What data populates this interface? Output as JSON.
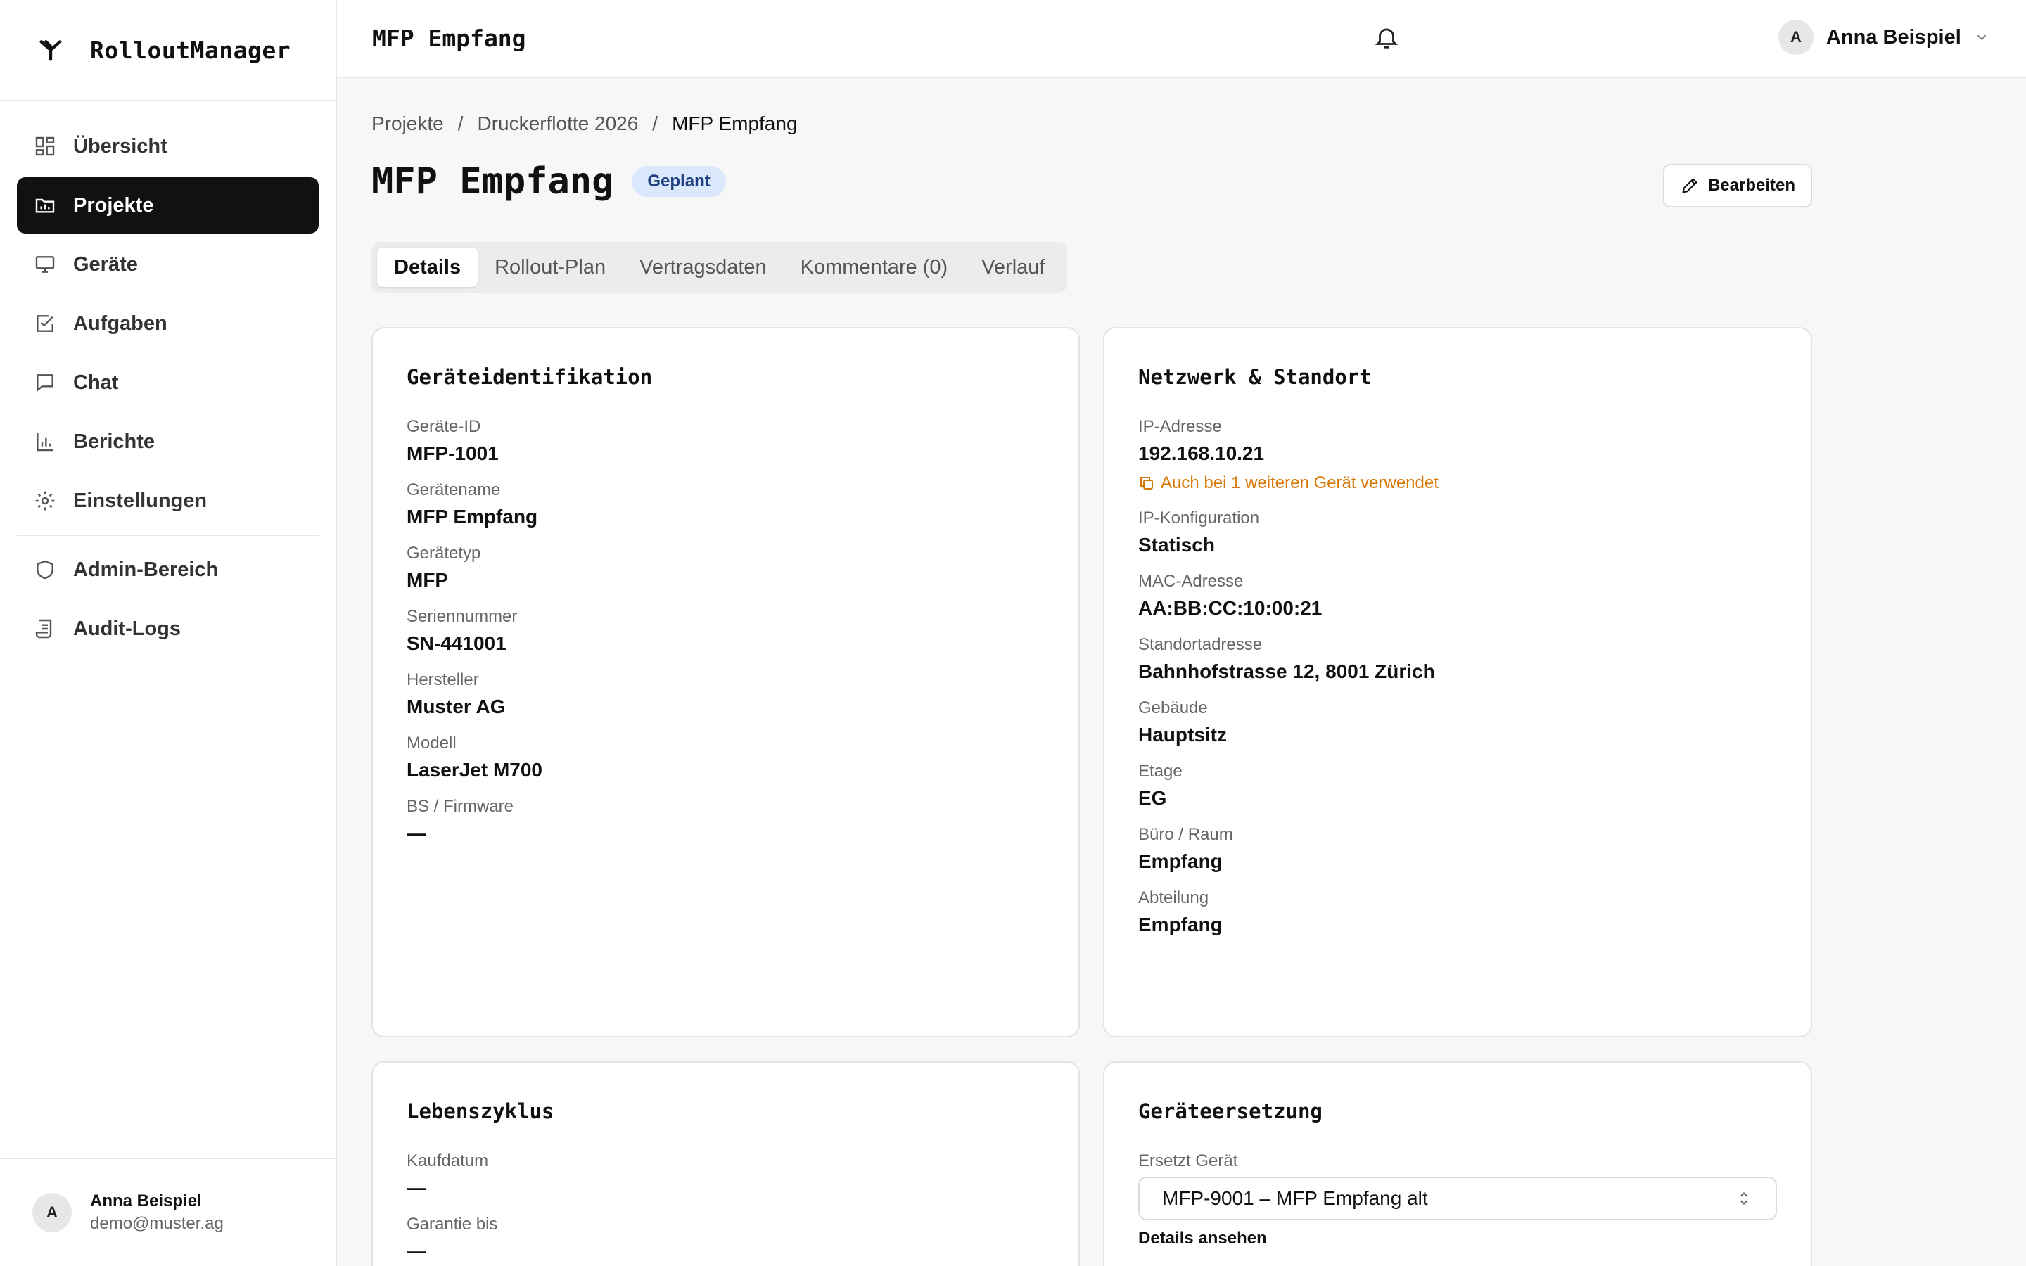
{
  "app": {
    "name": "RolloutManager"
  },
  "header": {
    "title": "MFP Empfang",
    "user_initial": "A",
    "user_name": "Anna Beispiel"
  },
  "sidebar": {
    "items": [
      {
        "label": "Übersicht",
        "icon": "grid-icon"
      },
      {
        "label": "Projekte",
        "icon": "folder-chart-icon",
        "active": true
      },
      {
        "label": "Geräte",
        "icon": "monitor-icon"
      },
      {
        "label": "Aufgaben",
        "icon": "checkbox-icon"
      },
      {
        "label": "Chat",
        "icon": "chat-icon"
      },
      {
        "label": "Berichte",
        "icon": "bar-chart-icon"
      },
      {
        "label": "Einstellungen",
        "icon": "gear-icon"
      }
    ],
    "admin_items": [
      {
        "label": "Admin-Bereich",
        "icon": "shield-icon"
      },
      {
        "label": "Audit-Logs",
        "icon": "scroll-icon"
      }
    ],
    "footer": {
      "initial": "A",
      "name": "Anna Beispiel",
      "email": "demo@muster.ag"
    }
  },
  "breadcrumb": {
    "items": [
      "Projekte",
      "Druckerflotte 2026",
      "MFP Empfang"
    ],
    "separator": "/"
  },
  "page": {
    "title": "MFP Empfang",
    "status": "Geplant",
    "edit_label": "Bearbeiten"
  },
  "tabs": [
    "Details",
    "Rollout-Plan",
    "Vertragsdaten",
    "Kommentare (0)",
    "Verlauf"
  ],
  "device_identification": {
    "title": "Geräteidentifikation",
    "fields": [
      {
        "label": "Geräte-ID",
        "value": "MFP-1001"
      },
      {
        "label": "Gerätename",
        "value": "MFP Empfang"
      },
      {
        "label": "Gerätetyp",
        "value": "MFP"
      },
      {
        "label": "Seriennummer",
        "value": "SN-441001"
      },
      {
        "label": "Hersteller",
        "value": "Muster AG"
      },
      {
        "label": "Modell",
        "value": "LaserJet M700"
      },
      {
        "label": "BS / Firmware",
        "value": "—"
      }
    ]
  },
  "network": {
    "title": "Netzwerk & Standort",
    "ip_label": "IP-Adresse",
    "ip_value": "192.168.10.21",
    "ip_warning": "Auch bei 1 weiteren Gerät verwendet",
    "fields": [
      {
        "label": "IP-Konfiguration",
        "value": "Statisch"
      },
      {
        "label": "MAC-Adresse",
        "value": "AA:BB:CC:10:00:21"
      },
      {
        "label": "Standortadresse",
        "value": "Bahnhofstrasse 12, 8001 Zürich"
      },
      {
        "label": "Gebäude",
        "value": "Hauptsitz"
      },
      {
        "label": "Etage",
        "value": "EG"
      },
      {
        "label": "Büro / Raum",
        "value": "Empfang"
      },
      {
        "label": "Abteilung",
        "value": "Empfang"
      }
    ]
  },
  "lifecycle": {
    "title": "Lebenszyklus",
    "fields": [
      {
        "label": "Kaufdatum",
        "value": "—"
      },
      {
        "label": "Garantie bis",
        "value": "—"
      }
    ]
  },
  "replacement": {
    "title": "Geräteersetzung",
    "label": "Ersetzt Gerät",
    "selected": "MFP-9001 – MFP Empfang alt",
    "details_link": "Details ansehen"
  },
  "colors": {
    "accent": "#111111",
    "badge_bg": "#dbe8fb",
    "badge_text": "#1e3f80",
    "warning": "#d97706"
  }
}
